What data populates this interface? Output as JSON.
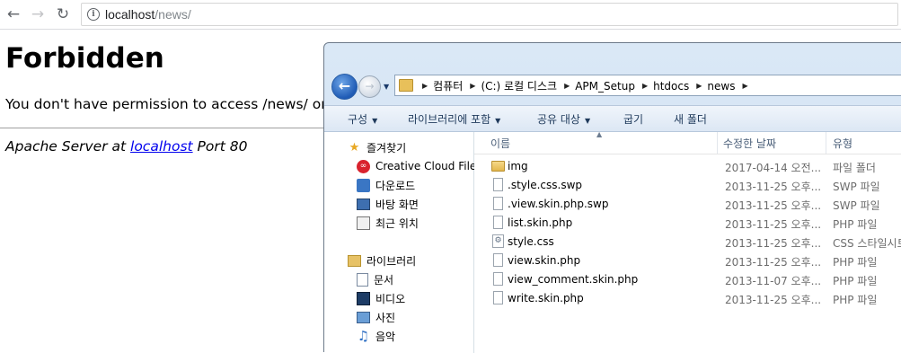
{
  "browser": {
    "url_host": "localhost",
    "url_path": "/news/"
  },
  "page": {
    "heading": "Forbidden",
    "message": "You don't have permission to access /news/ on t",
    "server_prefix": "Apache Server at ",
    "server_host": "localhost",
    "server_suffix": " Port 80"
  },
  "explorer": {
    "breadcrumb": [
      "컴퓨터",
      "(C:) 로컬 디스크",
      "APM_Setup",
      "htdocs",
      "news"
    ],
    "toolbar": {
      "organize": "구성",
      "include_library": "라이브러리에 포함",
      "share": "공유 대상",
      "burn": "굽기",
      "new_folder": "새 폴더"
    },
    "nav": {
      "favorites": "즐겨찾기",
      "creative_cloud": "Creative Cloud Files",
      "downloads": "다운로드",
      "desktop": "바탕 화면",
      "recent": "최근 위치",
      "libraries": "라이브러리",
      "documents": "문서",
      "videos": "비디오",
      "pictures": "사진",
      "music": "음악"
    },
    "columns": {
      "name": "이름",
      "modified": "수정한 날짜",
      "type": "유형"
    },
    "files": [
      {
        "name": "img",
        "date": "2017-04-14 오전...",
        "type": "파일 폴더",
        "icon": "folder"
      },
      {
        "name": ".style.css.swp",
        "date": "2013-11-25 오후...",
        "type": "SWP 파일",
        "icon": "file"
      },
      {
        "name": ".view.skin.php.swp",
        "date": "2013-11-25 오후...",
        "type": "SWP 파일",
        "icon": "file"
      },
      {
        "name": "list.skin.php",
        "date": "2013-11-25 오후...",
        "type": "PHP 파일",
        "icon": "file"
      },
      {
        "name": "style.css",
        "date": "2013-11-25 오후...",
        "type": "CSS 스타일시트",
        "icon": "css"
      },
      {
        "name": "view.skin.php",
        "date": "2013-11-25 오후...",
        "type": "PHP 파일",
        "icon": "file"
      },
      {
        "name": "view_comment.skin.php",
        "date": "2013-11-07 오후...",
        "type": "PHP 파일",
        "icon": "file"
      },
      {
        "name": "write.skin.php",
        "date": "2013-11-25 오후...",
        "type": "PHP 파일",
        "icon": "file"
      }
    ]
  }
}
